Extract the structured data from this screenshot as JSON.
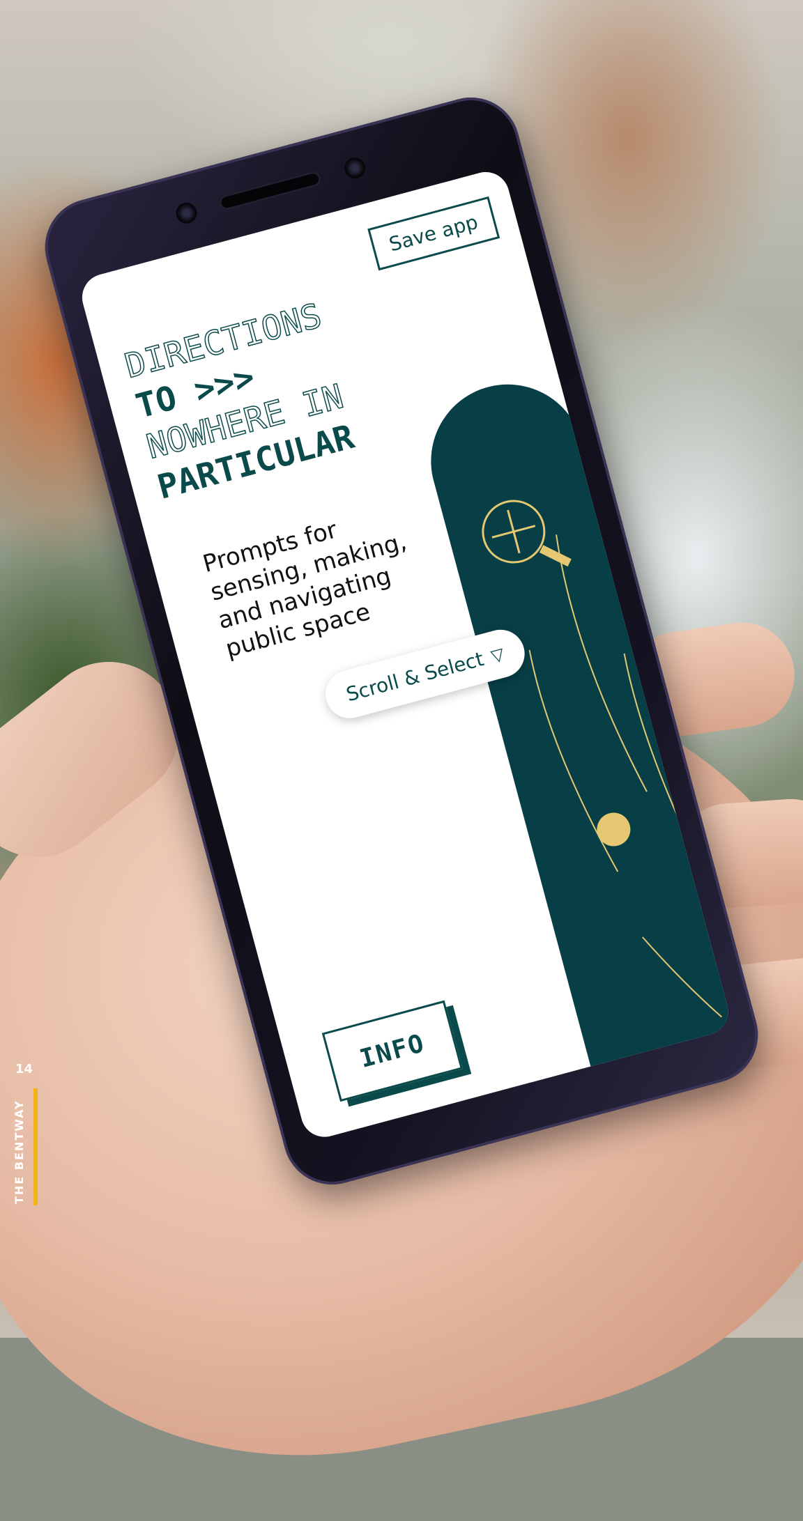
{
  "screen": {
    "save_app": "Save app",
    "title_lines": [
      "DIRECTIONS",
      "TO >>>",
      "NOWHERE IN",
      "PARTICULAR"
    ],
    "tagline": "Prompts for sensing, making, and navigating public space",
    "scroll_select": "Scroll & Select",
    "info": "INFO"
  },
  "page": {
    "number": "14",
    "label": "THE BENTWAY"
  },
  "colors": {
    "brand_teal": "#0b4a4a",
    "accent_gold": "#e6c872",
    "label_yellow": "#f2b316"
  },
  "icons": {
    "scroll_select": "triangle-pointer-icon"
  }
}
